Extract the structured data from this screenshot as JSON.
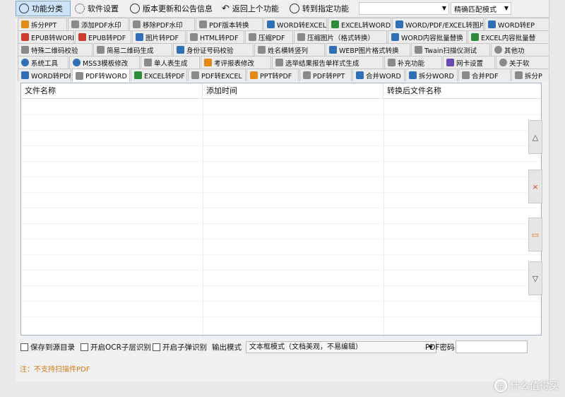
{
  "toolbar": {
    "function_category": "功能分类",
    "software_settings": "软件设置",
    "version_update": "版本更新和公告信息",
    "back_previous": "返回上个功能",
    "goto_function": "转到指定功能",
    "match_mode": "精确匹配模式"
  },
  "tabs": {
    "row1": [
      "拆分PPT",
      "添加PDF水印",
      "移除PDF水印",
      "PDF版本转换",
      "WORD转EXCEL",
      "EXCEL转WORD",
      "WORD/PDF/EXCEL转图片",
      "WORD转EP"
    ],
    "row2": [
      "EPUB转WORD",
      "EPUB转PDF",
      "图片转PDF",
      "HTML转PDF",
      "压缩PDF",
      "压缩图片（格式转换）",
      "WORD内容批量替换",
      "EXCEL内容批量替"
    ],
    "row3": [
      "特殊二维码校验",
      "简易二维码生成",
      "身份证号码校验",
      "姓名横转竖列",
      "WEBP图片格式转换",
      "Twain扫描仪测试",
      "其他功"
    ],
    "row4": [
      "系统工具",
      "MSS3模板修改",
      "单人表生成",
      "考评报表修改",
      "选举结果报告单样式生成",
      "补充功能",
      "网卡设置",
      "关于软"
    ],
    "row5": [
      "WORD转PDF",
      "PDF转WORD",
      "EXCEL转PDF",
      "PDF转EXCEL",
      "PPT转PDF",
      "PDF转PPT",
      "合并WORD",
      "拆分WORD",
      "合并PDF",
      "拆分P"
    ]
  },
  "table": {
    "col1": "文件名称",
    "col2": "添加时间",
    "col3": "转换后文件名称"
  },
  "side_buttons": {
    "up": "△",
    "delete": "×",
    "clear": "▭",
    "down": "▽"
  },
  "options": {
    "save_to_source": "保存到源目录",
    "enable_ocr": "开启OCR子层识别",
    "enable_popup": "开启子弹识别",
    "output_mode_label": "输出模式",
    "output_mode_value": "文本框模式（文档美观，不易编辑）",
    "pdf_password_label": "PDF密码"
  },
  "note": "注：不支持扫描件PDF",
  "watermark": "什么值得买",
  "colors": {
    "accent": "#2f6fb5",
    "note": "#d27c17",
    "active_tab": "#ffffff"
  }
}
